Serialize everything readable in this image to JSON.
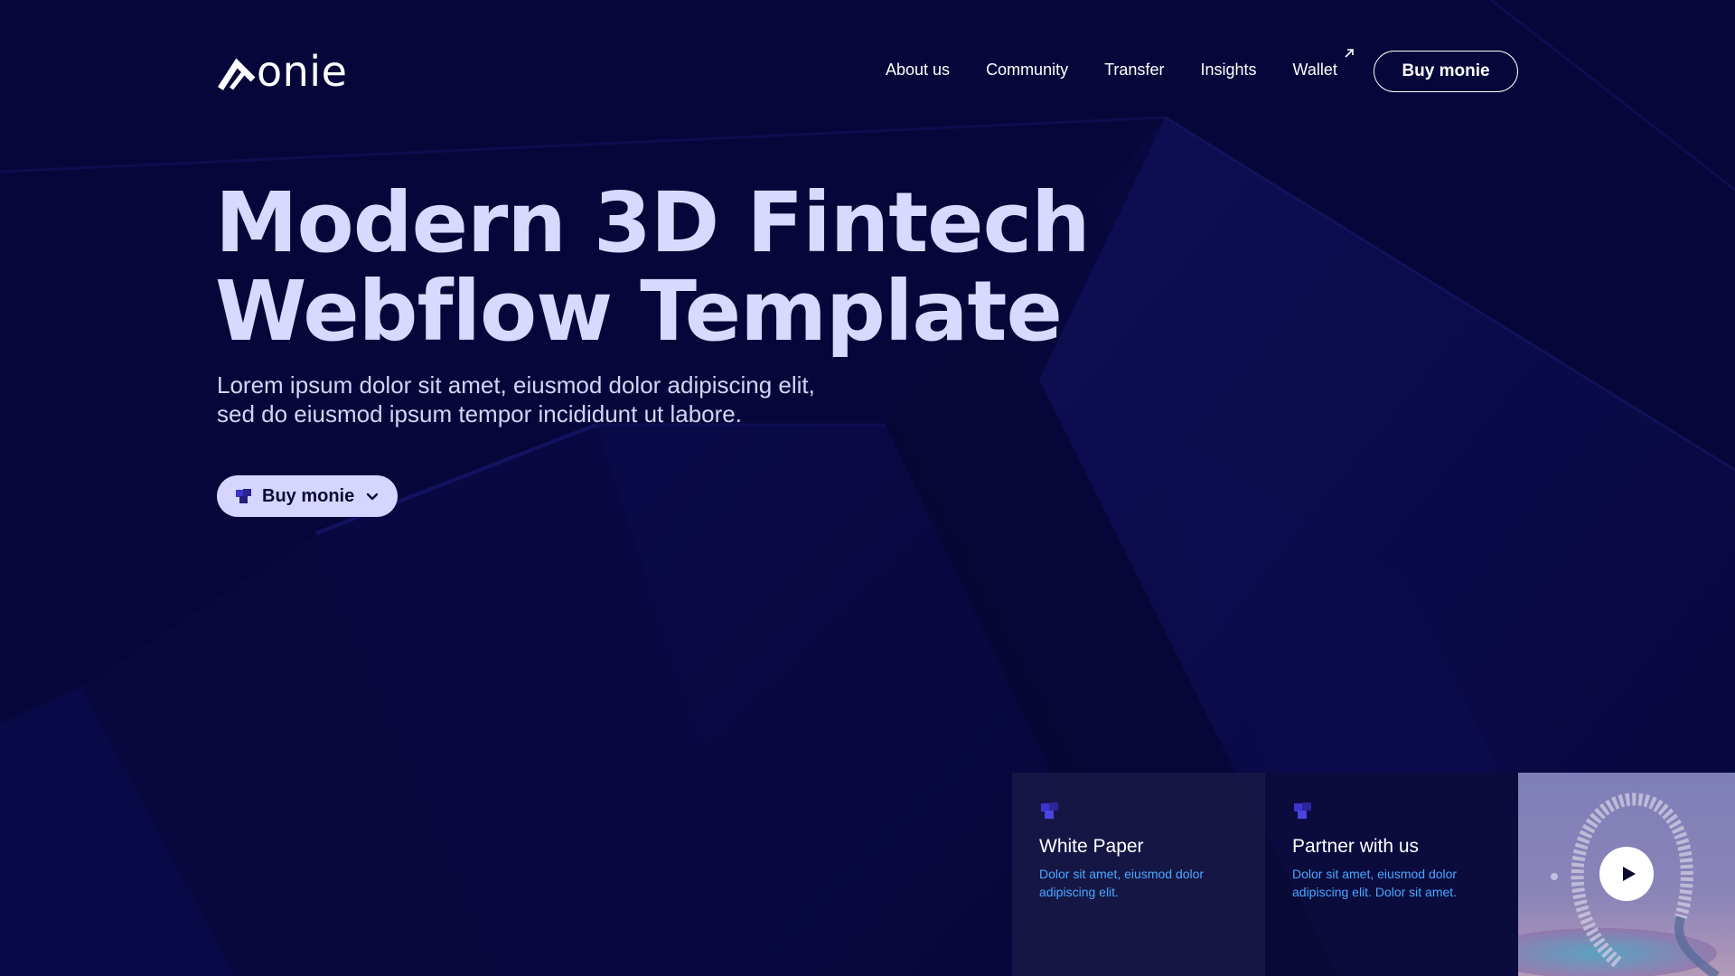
{
  "brand": {
    "logo_text": "onie"
  },
  "nav": {
    "links": [
      {
        "label": "About us"
      },
      {
        "label": "Community"
      },
      {
        "label": "Transfer"
      },
      {
        "label": "Insights"
      },
      {
        "label": "Wallet"
      }
    ],
    "cta_label": "Buy monie"
  },
  "hero": {
    "title_lines": [
      "Modern 3D Fintech",
      "Webflow Template"
    ],
    "subtitle_lines": [
      "Lorem ipsum dolor sit amet, eiusmod dolor adipiscing elit,",
      "sed do eiusmod ipsum tempor incididunt ut labore."
    ],
    "cta_label": "Buy monie"
  },
  "cards": [
    {
      "title": "White Paper",
      "desc": "Dolor sit amet, eiusmod dolor adipiscing elit.",
      "icon": "cubes-icon"
    },
    {
      "title": "Partner with us",
      "desc": "Dolor sit amet, eiusmod dolor adipiscing elit. Dolor sit amet.",
      "icon": "cubes-icon"
    }
  ],
  "colors": {
    "background": "#07063a",
    "hero_text": "#d9d9ff",
    "accent_button": "#d6d5ff",
    "card_desc": "#4aa8ff"
  }
}
